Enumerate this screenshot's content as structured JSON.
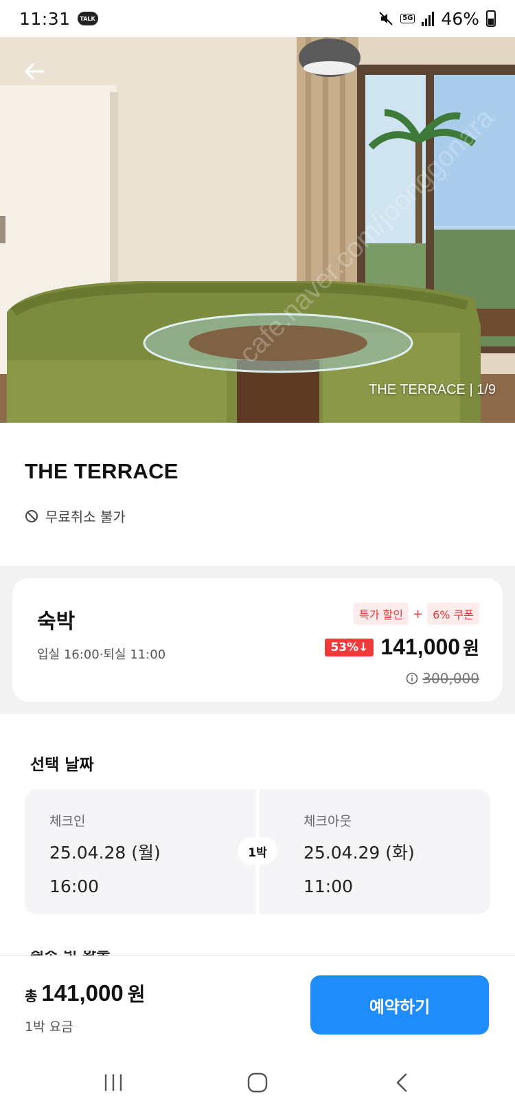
{
  "status_bar": {
    "time": "11:31",
    "talk_badge": "TALK",
    "network": "5G",
    "battery": "46%"
  },
  "hero": {
    "photo_caption": "THE TERRACE | 1/9",
    "watermark": "cafe.naver.com/joonggonara"
  },
  "room": {
    "title": "THE TERRACE",
    "cancel_policy": "무료취소 불가"
  },
  "stay": {
    "title": "숙박",
    "times": "입실 16:00·퇴실 11:00",
    "tag_special": "특가 할인",
    "tag_plus": "+",
    "tag_coupon": "6% 쿠폰",
    "discount": "53%↓",
    "price": "141,000",
    "price_unit": "원",
    "original_price": "300,000"
  },
  "dates": {
    "heading": "선택 날짜",
    "checkin_label": "체크인",
    "checkin_date": "25.04.28 (월)",
    "checkin_time": "16:00",
    "nights": "1박",
    "checkout_label": "체크아웃",
    "checkout_date": "25.04.29 (화)",
    "checkout_time": "11:00"
  },
  "next_section_peek": "취소 및 환불",
  "bottom": {
    "total_prefix": "총",
    "total_amount": "141,000",
    "total_unit": "원",
    "total_sub": "1박 요금",
    "reserve_label": "예약하기"
  },
  "colors": {
    "accent": "#1f8cfb",
    "discount": "#ef3b3b",
    "tag_bg": "#fdecec"
  },
  "icons": [
    "back-arrow-icon",
    "no-entry-icon",
    "info-icon",
    "recent-apps-icon",
    "home-icon",
    "back-nav-icon"
  ]
}
